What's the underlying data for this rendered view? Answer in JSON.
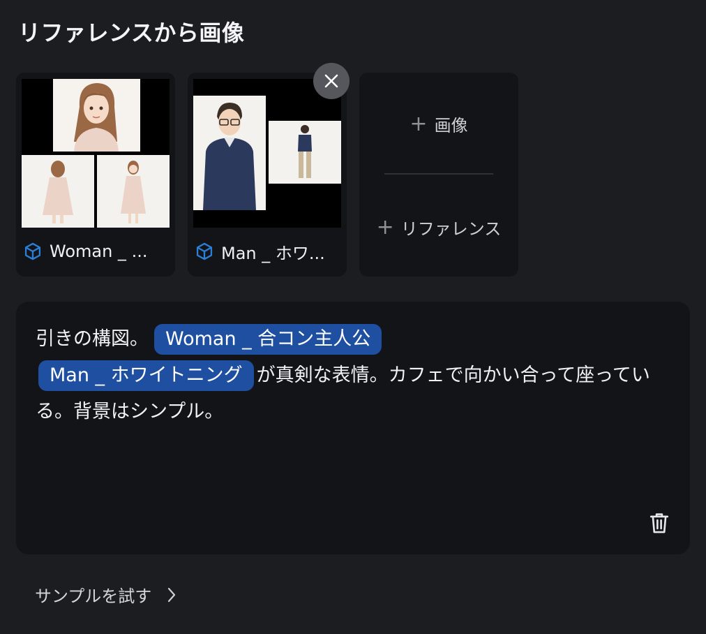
{
  "section_title": "リファレンスから画像",
  "references": [
    {
      "label": "Woman _ ...",
      "icon": "cube-icon"
    },
    {
      "label": "Man _ ホワ...",
      "icon": "cube-icon"
    }
  ],
  "add_card": {
    "image_label": "画像",
    "reference_label": "リファレンス"
  },
  "prompt": {
    "segment_1": "引きの構図。",
    "chip_1": "Woman _ 合コン主人公",
    "chip_2": "Man _ ホワイトニング",
    "segment_2": "が真剣な表情。カフェで向かい合って座っている。背景はシンプル。"
  },
  "try_sample": "サンプルを試す",
  "colors": {
    "accent": "#1f4fa0",
    "icon_blue": "#2b7fd8",
    "background": "#1c1d21",
    "card": "#131417"
  }
}
